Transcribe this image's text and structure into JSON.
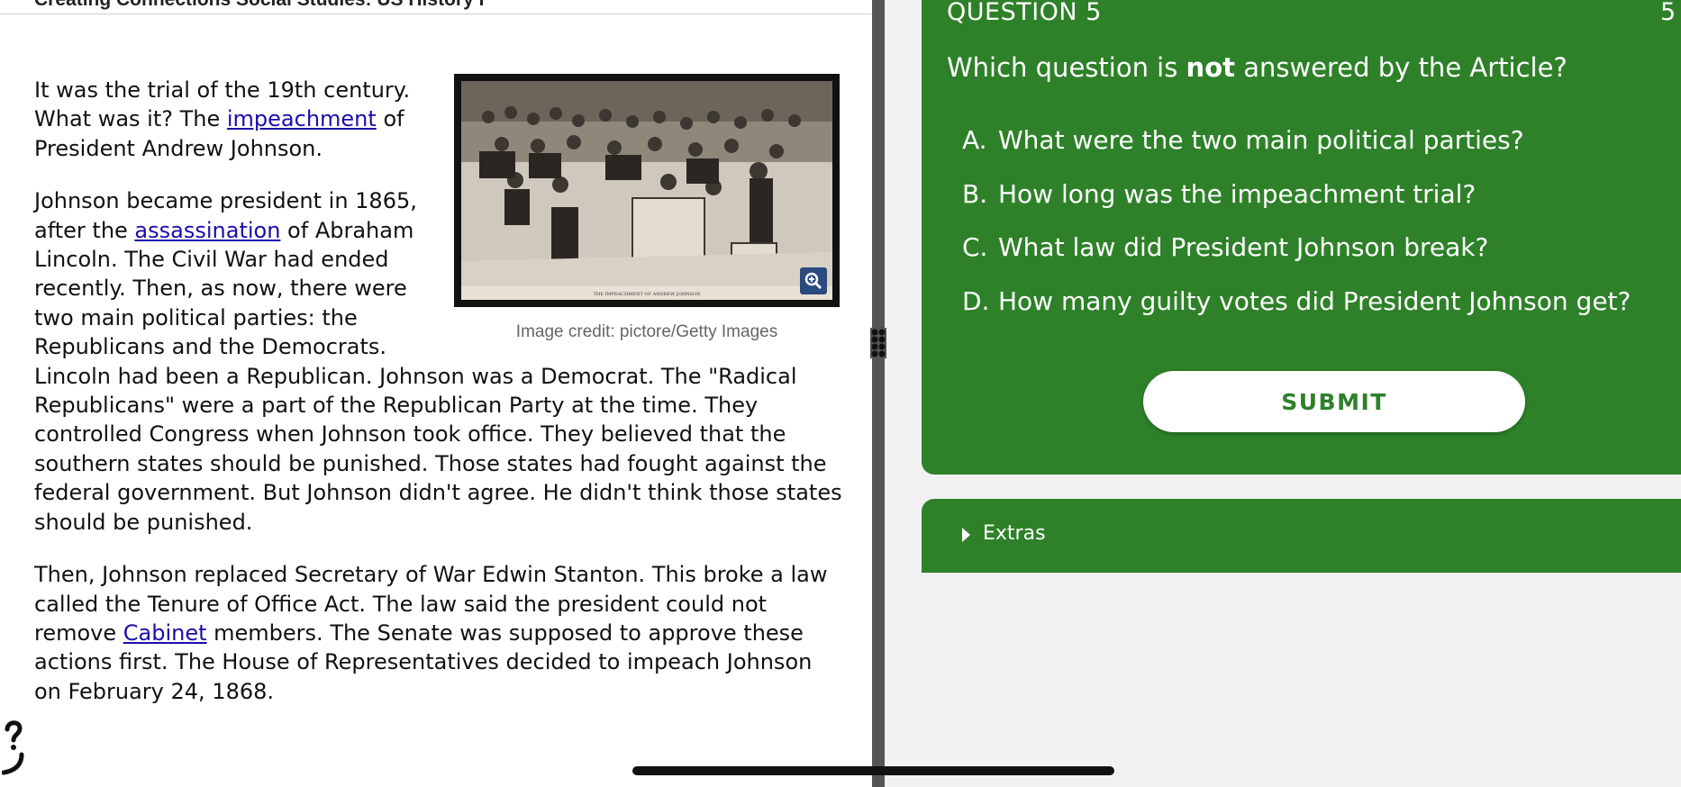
{
  "article": {
    "header_title": "Creating Connections Social Studies: US History I",
    "paragraphs": {
      "p1_a": "It was the trial of the 19th century. What was it? The ",
      "p1_link": "impeachment",
      "p1_b": " of President Andrew Johnson.",
      "p2_a": "Johnson became president in 1865, after the ",
      "p2_link": "assassination",
      "p2_b": " of Abraham Lincoln. The Civil War had ended recently. Then, as now, there were two main political parties: the Republicans and the Democrats. Lincoln had been a Republican. Johnson was a Democrat. The \"Radical Republicans\" were a part of the Republican Party at the time. They controlled Congress when Johnson took office. They believed that the southern states should be punished. Those states had fought against the federal government. But Johnson didn't agree. He didn't think those states should be punished.",
      "p3_a": "Then, Johnson replaced Secretary of War Edwin Stanton. This broke a law called the Tenure of Office Act. The law said the president could not remove ",
      "p3_link": "Cabinet",
      "p3_b": " members. The Senate was supposed to approve these actions first. The House of Representatives decided to impeach Johnson on February 24, 1868."
    },
    "image_caption": "Image credit: pictore/Getty Images",
    "image_subtitle": "THE IMPEACHMENT OF ANDREW JOHNSON",
    "zoom_icon": "zoom-in-icon"
  },
  "question": {
    "label": "QUESTION 5",
    "count": "5",
    "text_before": "Which question is ",
    "text_bold": "not",
    "text_after": " answered by the Article?",
    "answers": [
      {
        "letter": "A.",
        "text": "What were the two main political parties?"
      },
      {
        "letter": "B.",
        "text": "How long was the impeachment trial?"
      },
      {
        "letter": "C.",
        "text": "What law did President Johnson break?"
      },
      {
        "letter": "D.",
        "text": "How many guilty votes did President Johnson get?"
      }
    ],
    "submit_label": "SUBMIT"
  },
  "extras": {
    "label": "Extras"
  },
  "colors": {
    "panel_green": "#2e8129",
    "link_blue": "#1a0dab",
    "divider": "#555555"
  }
}
